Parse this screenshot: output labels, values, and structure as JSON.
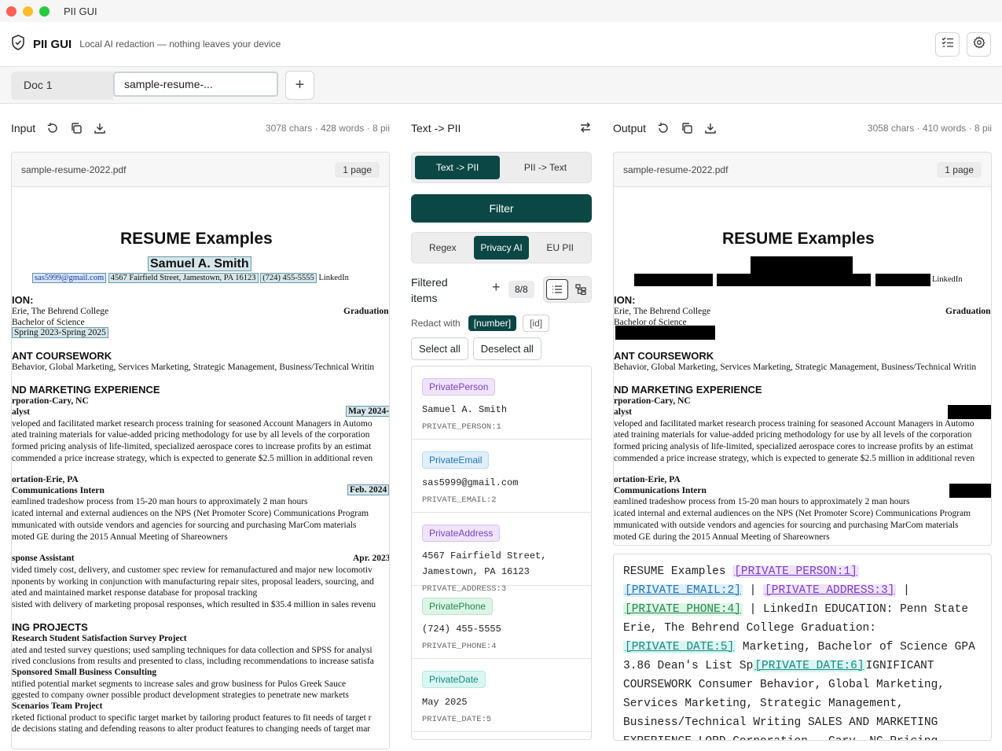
{
  "window": {
    "title": "PII GUI"
  },
  "header": {
    "app_name": "PII GUI",
    "tagline": "Local AI redaction — nothing leaves your device"
  },
  "tabs": {
    "doc1": "Doc 1",
    "doc2": "sample-resume-...",
    "add": "+"
  },
  "input": {
    "label": "Input",
    "stats": "3078 chars · 428 words · 8 pii",
    "filename": "sample-resume-2022.pdf",
    "pages": "1 page"
  },
  "output": {
    "label": "Output",
    "stats": "3058 chars · 410 words · 8 pii",
    "filename": "sample-resume-2022.pdf",
    "pages": "1 page"
  },
  "resume": {
    "title": "RESUME Examples",
    "name": "Samuel A. Smith",
    "email": "sas5999@gmail.com",
    "address": "4567 Fairfield Street, Jamestown, PA 16123",
    "phone": "(724) 455-5555",
    "linkedin": "LinkedIn",
    "l_ion": "ION:",
    "l_erie": "Erie, The Behrend College",
    "l_grad": "Graduation",
    "l_bachelor": "Bachelor of Science",
    "l_dates": "Spring 2023-Spring 2025",
    "l_course": "ANT COURSEWORK",
    "l_course_text": "Behavior, Global Marketing, Services Marketing, Strategic Management, Business/Technical Writin",
    "l_mkt": "ND MARKETING EXPERIENCE",
    "l_corp": "rporation-Cary, NC",
    "l_alyst": "alyst",
    "l_may": "May 2024-",
    "l_b1": "veloped and facilitated market research process training for seasoned Account Managers in Automo",
    "l_b2": "ated training materials for value-added pricing methodology for use by all levels of the corporation",
    "l_b3": "formed pricing analysis of life-limited, specialized aerospace cores to increase profits by an estimat",
    "l_b4": "commended a price increase strategy, which is expected to generate $2.5 million in additional reven",
    "l_port": "ortation-Erie, PA",
    "l_comm": "Communications Intern",
    "l_feb": "Feb. 2024",
    "l_c1": "eamlined tradeshow process from 15-20 man hours to approximately 2 man hours",
    "l_c2": "icated internal and external audiences on the NPS (Net Promoter Score) Communications Program",
    "l_c3": "mmunicated with outside vendors and agencies for sourcing and purchasing MarCom materials",
    "l_c4": "moted GE during the 2015 Annual Meeting of Shareowners",
    "l_resp": "sponse Assistant",
    "l_apr": "Apr. 2023",
    "l_d1": "vided timely cost, delivery, and customer spec review for remanufactured and major new locomotiv",
    "l_d2": "nponents by working in conjunction with manufacturing repair sites, proposal leaders, sourcing, and",
    "l_d3": "ated and maintained market response database for proposal tracking",
    "l_d4": "sisted with delivery of marketing proposal responses, which resulted in $35.4 million in sales revenu",
    "l_proj": "ING PROJECTS",
    "l_p1": "Research Student Satisfaction Survey Project",
    "l_p2": "ated and tested survey questions; used sampling techniques for data collection and SPSS for analysi",
    "l_p3": "rived conclusions from results and presented to class, including recommendations to increase satisfa",
    "l_p4": "Sponsored Small Business Consulting",
    "l_p5": "ntified potential market segments to increase sales and grow business for Pulos Greek Sauce",
    "l_p6": "ggested to company owner possible product development strategies to penetrate new markets",
    "l_p7": "Scenarios Team Project",
    "l_p8": "rketed fictional product to specific target market by tailoring product features to fit needs of target r",
    "l_p9": "de decisions stating and defending reasons to alter product features to changing needs of target mar"
  },
  "middle": {
    "label": "Text -> PII",
    "mode_a": "Text -> PII",
    "mode_b": "PII -> Text",
    "filter": "Filter",
    "src_regex": "Regex",
    "src_ai": "Privacy AI",
    "src_eu": "EU PII",
    "filtered_label": "Filtered items",
    "plus": "+",
    "count": "8/8",
    "redact_label": "Redact with",
    "redact_number": "[number]",
    "redact_id": "[id]",
    "select_all": "Select all",
    "deselect_all": "Deselect all",
    "items": [
      {
        "tag": "PrivatePerson",
        "value": "Samuel A. Smith",
        "ref": "PRIVATE_PERSON:1",
        "bg": "#efe4fb",
        "fg": "#7b3fc4",
        "bd": "#d9c2f2"
      },
      {
        "tag": "PrivateEmail",
        "value": "sas5999@gmail.com",
        "ref": "PRIVATE_EMAIL:2",
        "bg": "#dff0fb",
        "fg": "#2374b8",
        "bd": "#b9dbf2"
      },
      {
        "tag": "PrivateAddress",
        "value": "4567 Fairfield Street, Jamestown, PA 16123",
        "ref": "PRIVATE_ADDRESS:3",
        "bg": "#efe4fb",
        "fg": "#7b3fc4",
        "bd": "#d9c2f2"
      },
      {
        "tag": "PrivatePhone",
        "value": "(724) 455-5555",
        "ref": "PRIVATE_PHONE:4",
        "bg": "#ddf5e6",
        "fg": "#1f8a4c",
        "bd": "#b8e6c9"
      },
      {
        "tag": "PrivateDate",
        "value": "May 2025",
        "ref": "PRIVATE_DATE:5",
        "bg": "#daf6f3",
        "fg": "#148a7d",
        "bd": "#b3e9e2"
      }
    ]
  },
  "output_text": {
    "t1": "RESUME Examples ",
    "p1": "[PRIVATE_PERSON:1]",
    "p2": "[PRIVATE_EMAIL:2]",
    "t2": " | ",
    "p3": "[PRIVATE_ADDRESS:3]",
    "t3": " | ",
    "p4": "[PRIVATE_PHONE:4]",
    "t4": " | LinkedIn EDUCATION: Penn State Erie, The Behrend College Graduation: ",
    "p5": "[PRIVATE_DATE:5]",
    "t5": " Marketing, Bachelor of Science GPA 3.86 Dean's List Sp",
    "p6": "[PRIVATE_DATE:6]",
    "t6": "IGNIFICANT COURSEWORK Consumer Behavior, Global Marketing, Services Marketing, Strategic Management, Business/Technical Writing SALES AND MARKETING EXPERIENCE LORD Corporation – Cary, NC Pricing"
  },
  "colors": {
    "accent": "#0b4745"
  }
}
